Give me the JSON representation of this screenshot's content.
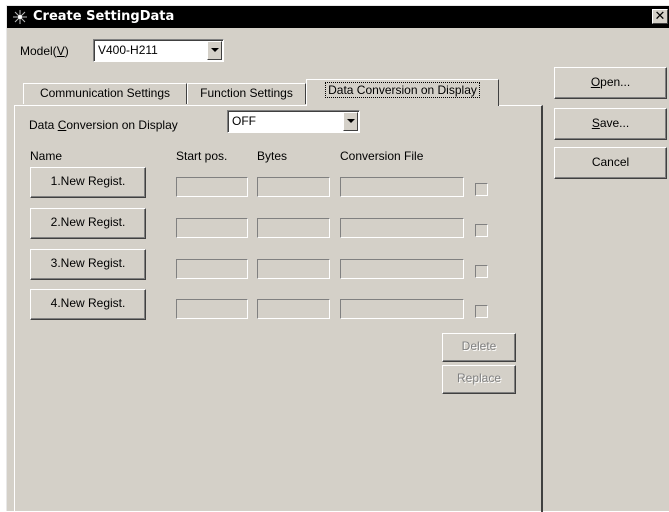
{
  "window": {
    "title": "Create SettingData",
    "close_glyph": "✕"
  },
  "model": {
    "label_before": "Model(",
    "label_key": "V",
    "label_after": ")",
    "value": "V400-H211"
  },
  "tabs": [
    {
      "label": "Communication Settings"
    },
    {
      "label": "Function Settings"
    },
    {
      "label": "Data Conversion on Display"
    }
  ],
  "conversion": {
    "label_before": "Data ",
    "label_key": "C",
    "label_after": "onversion on Display",
    "value": "OFF"
  },
  "columns": {
    "name": "Name",
    "start": "Start pos.",
    "bytes": "Bytes",
    "file": "Conversion File"
  },
  "rows": [
    {
      "button": "1.New Regist."
    },
    {
      "button": "2.New Regist."
    },
    {
      "button": "3.New Regist."
    },
    {
      "button": "4.New Regist."
    }
  ],
  "actions": {
    "delete": "Delete",
    "replace": "Replace"
  },
  "side_buttons": {
    "open_key": "O",
    "open_rest": "pen...",
    "save_key": "S",
    "save_rest": "ave...",
    "cancel": "Cancel"
  },
  "icons": {
    "app": "gear-sparkle-icon",
    "close": "close-icon",
    "dropdown": "chevron-down-icon"
  }
}
